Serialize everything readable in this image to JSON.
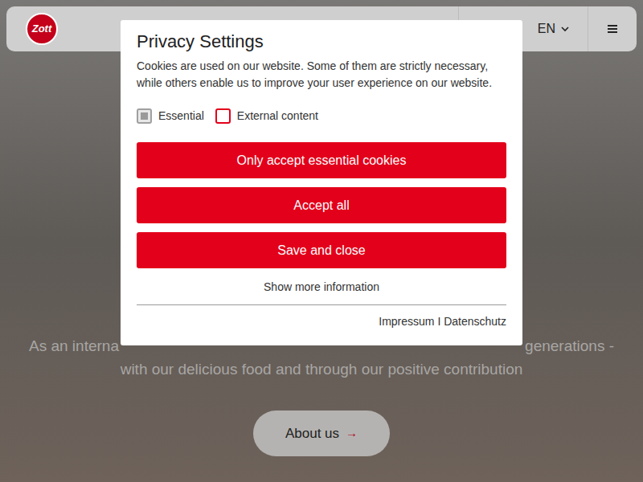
{
  "header": {
    "logo": "Zott",
    "language": "EN"
  },
  "hero": {
    "line1_left": "As an interna",
    "line1_right": "generations -",
    "line2": "with our delicious food and through our positive contribution",
    "button": "About us",
    "button_arrow": "→"
  },
  "dialog": {
    "title": "Privacy Settings",
    "text": "Cookies are used on our website. Some of them are strictly necessary, while others enable us to improve your user experience on our website.",
    "options": [
      {
        "label": "Essential",
        "checked": true,
        "disabled": true
      },
      {
        "label": "External content",
        "checked": false,
        "disabled": false
      }
    ],
    "buttons": [
      "Only accept essential cookies",
      "Accept all",
      "Save and close"
    ],
    "more_info": "Show more information",
    "footer": "Impressum I Datenschutz"
  }
}
